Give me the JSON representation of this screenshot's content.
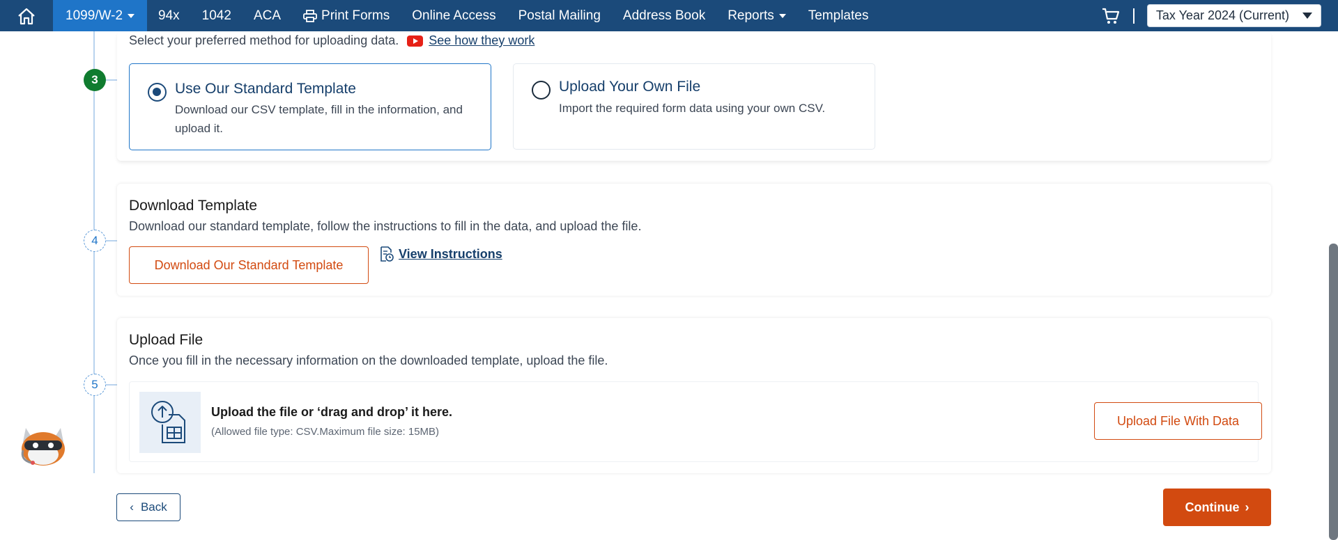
{
  "nav": {
    "items": [
      {
        "label": "1099/W-2",
        "active": true,
        "dropdown": true
      },
      {
        "label": "94x"
      },
      {
        "label": "1042"
      },
      {
        "label": "ACA"
      },
      {
        "label": "Print Forms",
        "icon": "printer-icon"
      },
      {
        "label": "Online Access"
      },
      {
        "label": "Postal Mailing"
      },
      {
        "label": "Address Book"
      },
      {
        "label": "Reports",
        "dropdown": true
      },
      {
        "label": "Templates"
      }
    ],
    "separator": "|",
    "tax_year": "Tax Year 2024 (Current)"
  },
  "steps": [
    "3",
    "4",
    "5"
  ],
  "method": {
    "description": "Select your preferred method for uploading data.",
    "video_link": "See how they work",
    "options": [
      {
        "title": "Use Our Standard Template",
        "desc": "Download our CSV template, fill in the information, and upload it.",
        "selected": true
      },
      {
        "title": "Upload Your Own File",
        "desc": "Import the required form data using your own CSV.",
        "selected": false
      }
    ]
  },
  "download": {
    "title": "Download Template",
    "desc": "Download our standard template, follow the instructions to fill in the data, and upload the file.",
    "button": "Download Our Standard Template",
    "instructions_link": "View Instructions"
  },
  "upload": {
    "title": "Upload File",
    "desc": "Once you fill in the necessary information on the downloaded template, upload the file.",
    "drop_title": "Upload the file or ‘drag and drop’ it here.",
    "drop_hint": "(Allowed file type: CSV.Maximum file size: 15MB)",
    "button": "Upload File With Data"
  },
  "footer": {
    "back": "Back",
    "continue": "Continue"
  },
  "colors": {
    "nav_bg": "#1b4a7a",
    "nav_active": "#1f75c8",
    "accent_orange": "#d24a10",
    "step_done": "#107c2f"
  }
}
